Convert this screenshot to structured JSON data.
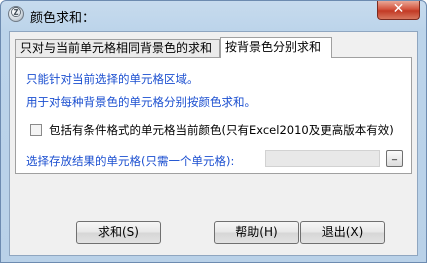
{
  "window": {
    "title": "颜色求和：",
    "app_icon": "Ⓩ",
    "close_symbol": "✕",
    "colors": {
      "frame": "#bcd4ea",
      "close": "#c8432e",
      "info_text": "#1b4fd0"
    }
  },
  "tabs": [
    {
      "label": "只对与当前单元格相同背景色的求和",
      "selected": false
    },
    {
      "label": "按背景色分别求和",
      "selected": true
    }
  ],
  "panel": {
    "info_line1": "只能针对当前选择的单元格区域。",
    "info_line2": "用于对每种背景色的单元格分别按颜色求和。",
    "checkbox": {
      "label": "包括有条件格式的单元格当前颜色(只有Excel2010及更高版本有效)",
      "checked": false
    },
    "target": {
      "label": "选择存放结果的单元格(只需一个单元格):",
      "value": "",
      "pick_button_label": "_"
    }
  },
  "buttons": {
    "sum": "求和(S)",
    "help": "帮助(H)",
    "exit": "退出(X)"
  }
}
